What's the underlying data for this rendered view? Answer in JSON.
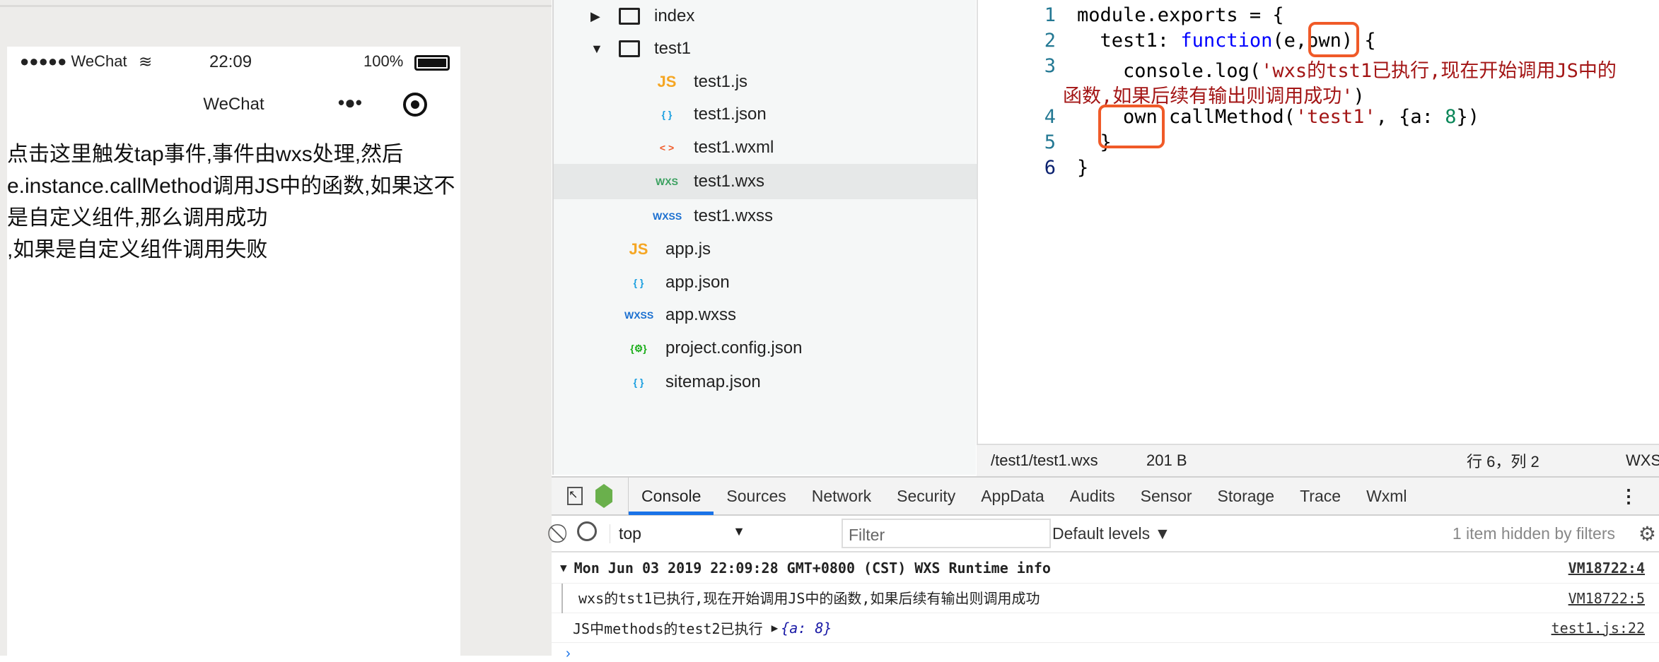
{
  "phone": {
    "carrier": "●●●●● WeChat",
    "time": "22:09",
    "battery": "100%",
    "nav_title": "WeChat",
    "menu_dots": "•●•",
    "content": "点击这里触发tap事件,事件由wxs处理,然后e.instance.callMethod调用JS中的函数,如果这不是自定义组件,那么调用成功\n,如果是自定义组件调用失败"
  },
  "tree": [
    {
      "label": "index",
      "icon": "▶",
      "kind": "folder"
    },
    {
      "label": "test1",
      "icon": "▼",
      "kind": "folder-open"
    },
    {
      "label": "test1.js",
      "icon": "JS",
      "color": "#f5a623"
    },
    {
      "label": "test1.json",
      "icon": "{ }",
      "color": "#1a9fe0"
    },
    {
      "label": "test1.wxml",
      "icon": "< >",
      "color": "#f05a28"
    },
    {
      "label": "test1.wxs",
      "icon": "WXS",
      "color": "#3aa05f"
    },
    {
      "label": "test1.wxss",
      "icon": "WXSS",
      "color": "#1a6fd0"
    },
    {
      "label": "app.js",
      "icon": "JS",
      "color": "#f5a623"
    },
    {
      "label": "app.json",
      "icon": "{ }",
      "color": "#1a9fe0"
    },
    {
      "label": "app.wxss",
      "icon": "WXSS",
      "color": "#1a6fd0"
    },
    {
      "label": "project.config.json",
      "icon": "{⚙}",
      "color": "#1aad19"
    },
    {
      "label": "sitemap.json",
      "icon": "{ }",
      "color": "#1a9fe0"
    }
  ],
  "editor": {
    "line_numbers": [
      "1",
      "2",
      "3",
      "4",
      "5",
      "6"
    ],
    "l1": "module.exports = {",
    "l2a": "  test1: ",
    "l2b": "function",
    "l2c": "(e,own) {",
    "l3a": "    console.log(",
    "l3b": "'wxs的tst1已执行,现在开始调用JS中的",
    "l3c": "函数,如果后续有输出则调用成功'",
    "l3d": ")",
    "l4a": "    own.callMethod(",
    "l4b": "'test1'",
    "l4c": ", {a: ",
    "l4d": "8",
    "l4e": "})",
    "l5": "  }",
    "l6": "}"
  },
  "editor_status": {
    "path": "/test1/test1.wxs",
    "size": "201 B",
    "position": "行 6，列 2",
    "lang": "WXS"
  },
  "devtools": {
    "tabs": [
      "Console",
      "Sources",
      "Network",
      "Security",
      "AppData",
      "Audits",
      "Sensor",
      "Storage",
      "Trace",
      "Wxml"
    ],
    "context": "top",
    "filter_placeholder": "Filter",
    "levels": "Default levels ▼",
    "hidden": "1 item hidden by filters"
  },
  "console": [
    {
      "text": "Mon Jun 03 2019 22:09:28 GMT+0800 (CST) WXS Runtime info",
      "source": "VM18722:4"
    },
    {
      "text": "wxs的tst1已执行,现在开始调用JS中的函数,如果后续有输出则调用成功",
      "source": "VM18722:5"
    },
    {
      "text": "JS中methods的test2已执行",
      "obj": "{a: 8}",
      "source": "test1.js:22"
    }
  ]
}
